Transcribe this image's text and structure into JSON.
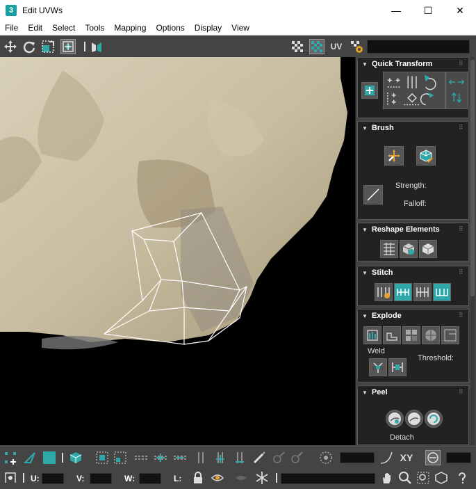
{
  "window": {
    "title": "Edit UVWs",
    "app_icon_label": "3",
    "controls": {
      "minimize": "—",
      "maximize": "☐",
      "close": "✕"
    }
  },
  "menu": [
    "File",
    "Edit",
    "Select",
    "Tools",
    "Mapping",
    "Options",
    "Display",
    "View"
  ],
  "toolbar_top": {
    "uv_label": "UV",
    "icons": [
      "move-icon",
      "rotate-icon",
      "scale-icon",
      "freeform-icon",
      "mirror-icon",
      "checker-icon",
      "texture-icon",
      "uv-toggle-icon",
      "settings-icon"
    ]
  },
  "viewport": {
    "background_color": "#000000",
    "texture_colors": [
      "#d6cdb6",
      "#b9ad93",
      "#8c7b60",
      "#a08663"
    ],
    "uv_wire_color": "#ffffff"
  },
  "panel": {
    "quick_transform": {
      "title": "Quick Transform"
    },
    "brush": {
      "title": "Brush",
      "strength_label": "Strength:",
      "falloff_label": "Falloff:"
    },
    "reshape_elements": {
      "title": "Reshape Elements"
    },
    "stitch": {
      "title": "Stitch"
    },
    "explode": {
      "title": "Explode",
      "weld_label": "Weld",
      "threshold_label": "Threshold:"
    },
    "peel": {
      "title": "Peel",
      "detach_label": "Detach"
    },
    "accent_color": "#2ea8a8"
  },
  "toolbar_bottom": {
    "xy_label": "XY",
    "u_label": "U:",
    "v_label": "V:",
    "w_label": "W:",
    "l_label": "L:"
  }
}
